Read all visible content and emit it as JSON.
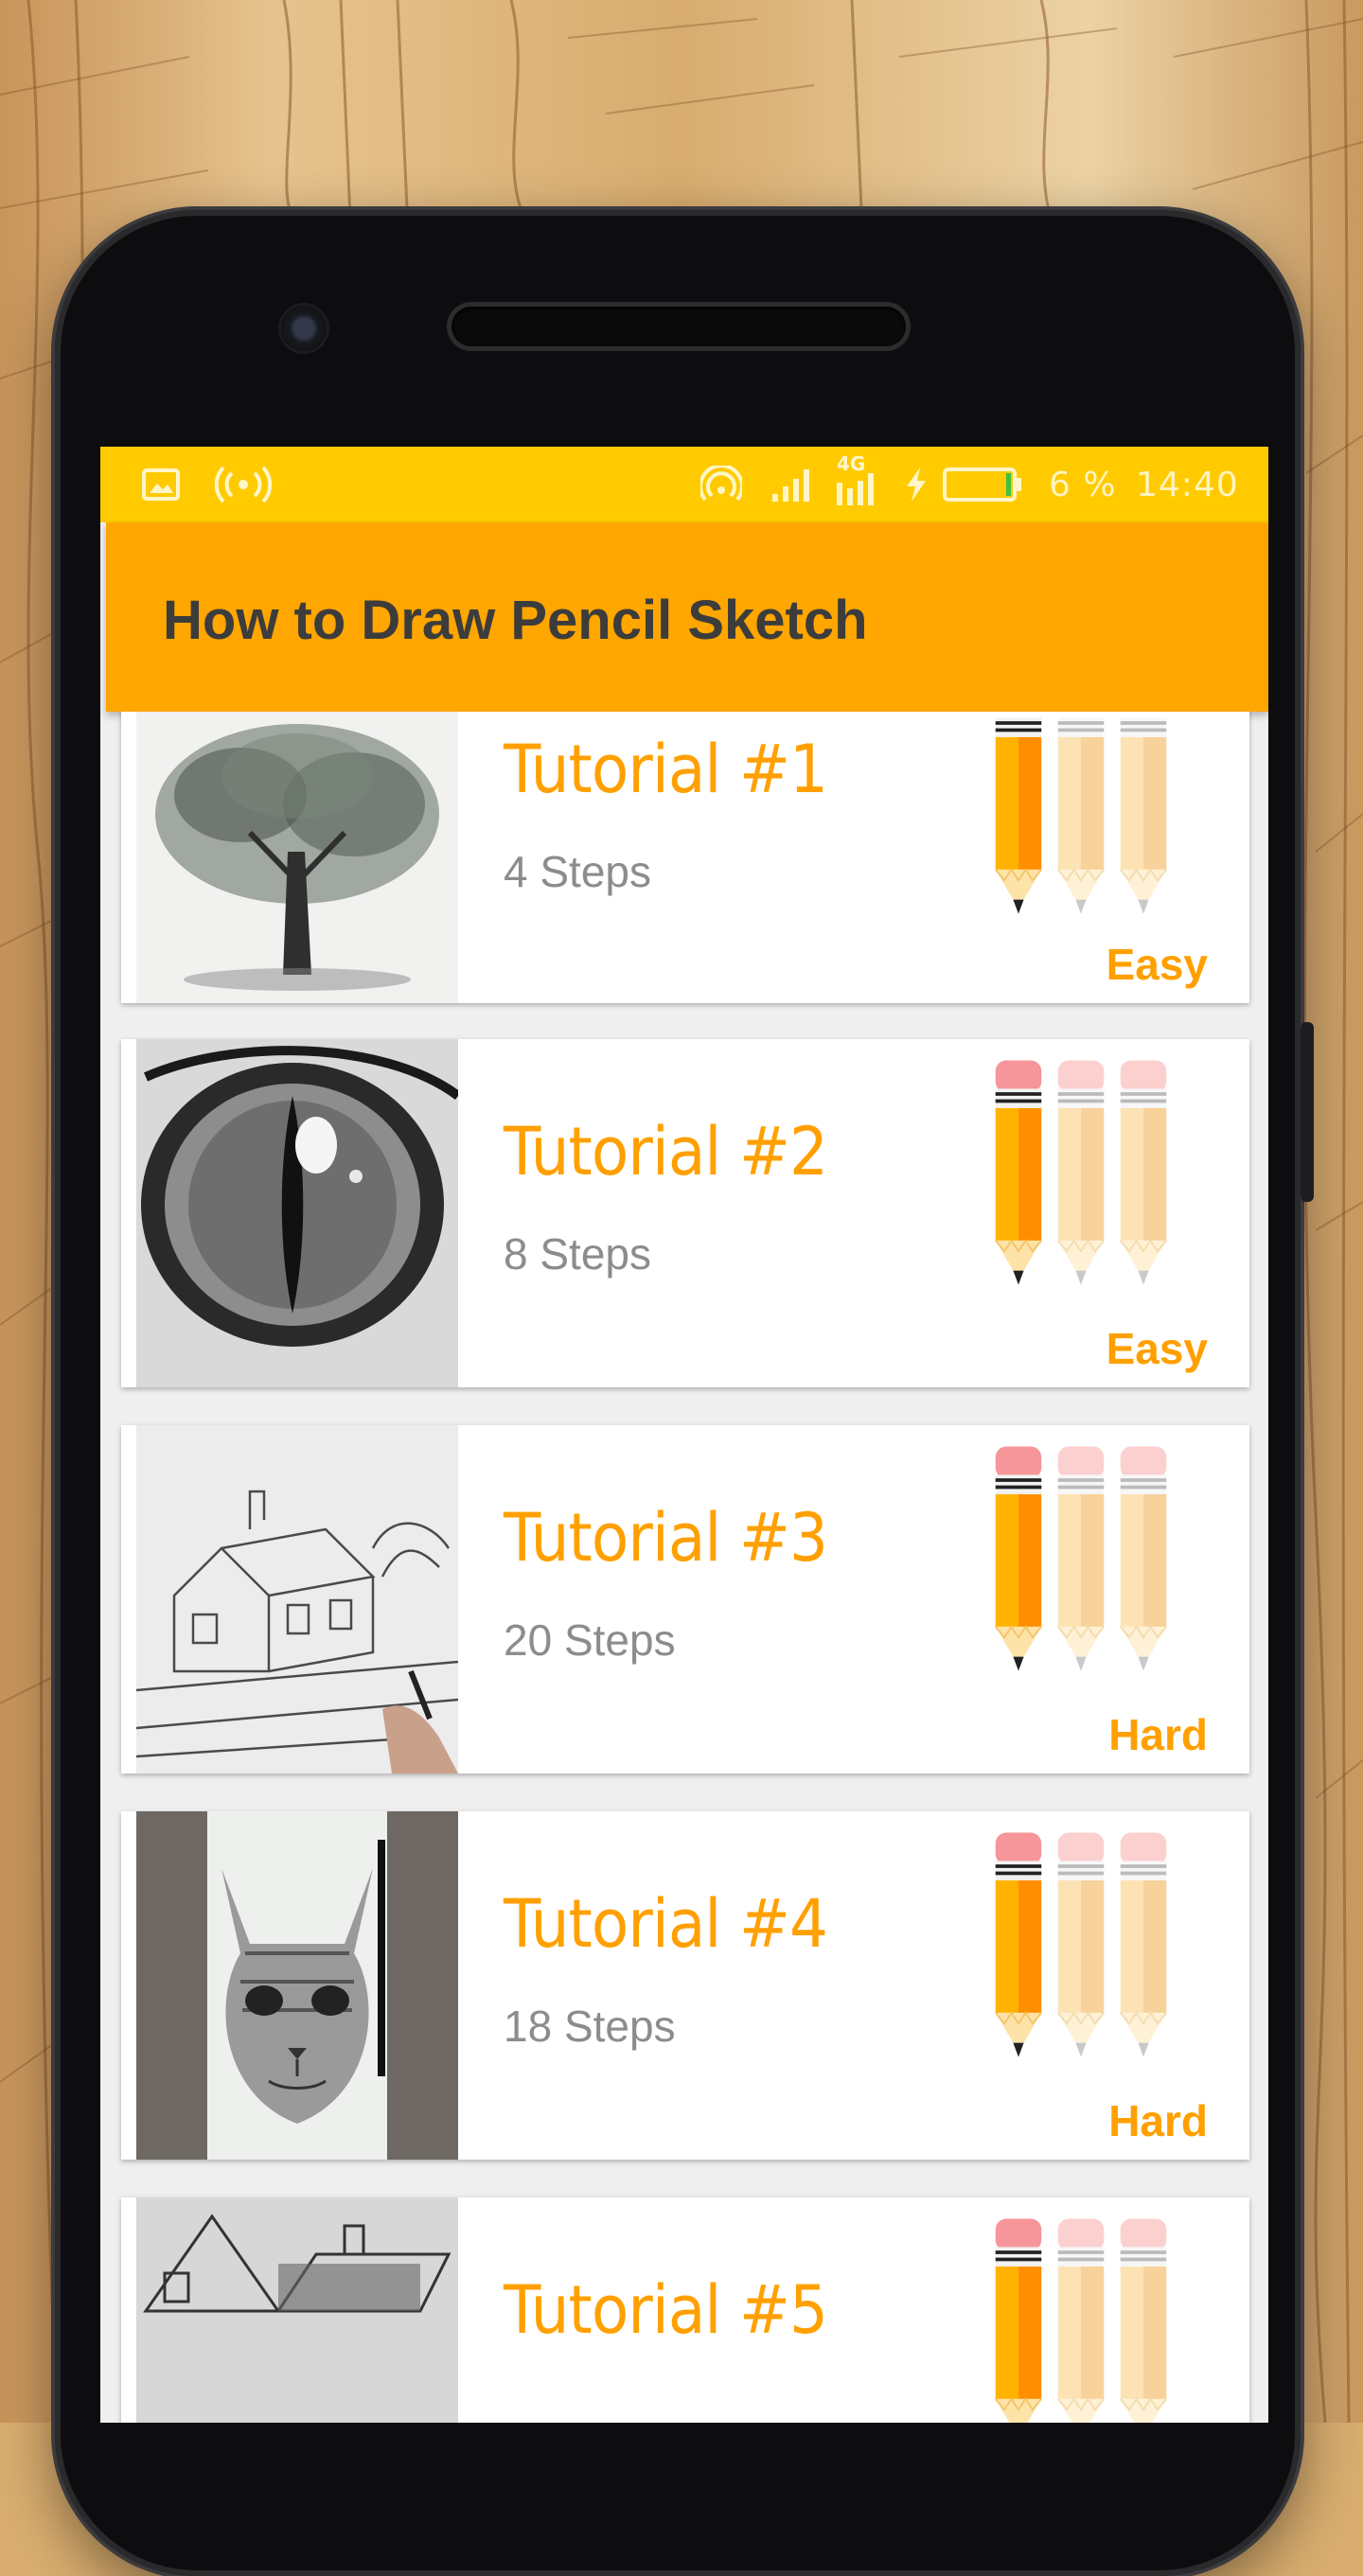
{
  "status_bar": {
    "battery_percent": "6 %",
    "time": "14:40",
    "network_label": "4G",
    "icons": [
      "gallery-icon",
      "broadcast-icon",
      "hotspot-icon",
      "signal-icon",
      "signal-4g-icon",
      "charging-icon",
      "battery-icon"
    ]
  },
  "app_bar": {
    "title": "How to Draw Pencil Sketch"
  },
  "tutorials": [
    {
      "title": "Tutorial #1",
      "steps": "4 Steps",
      "difficulty": "Easy",
      "level": 1,
      "image": "tree-sketch"
    },
    {
      "title": "Tutorial #2",
      "steps": "8 Steps",
      "difficulty": "Easy",
      "level": 1,
      "image": "cat-eye-sketch"
    },
    {
      "title": "Tutorial #3",
      "steps": "20 Steps",
      "difficulty": "Hard",
      "level": 1,
      "image": "cottage-sketch"
    },
    {
      "title": "Tutorial #4",
      "steps": "18 Steps",
      "difficulty": "Hard",
      "level": 1,
      "image": "cat-face-sketch"
    },
    {
      "title": "Tutorial #5",
      "steps": "",
      "difficulty": "",
      "level": 1,
      "image": "house-sketch"
    }
  ],
  "colors": {
    "status_bar": "#ffcb00",
    "app_bar": "#ffa600",
    "accent": "#ffa000",
    "pencil_active": "#ffb300",
    "pencil_inactive": "#fde2b4"
  }
}
